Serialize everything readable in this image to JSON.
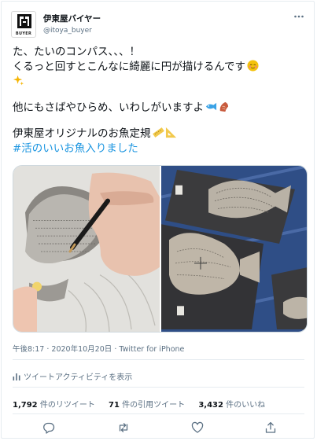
{
  "account": {
    "display_name": "伊東屋バイヤー",
    "handle": "@itoya_buyer",
    "avatar_text": "BUYER"
  },
  "tweet": {
    "line1": "た、たいのコンパス、、、！",
    "line2": "くるっと回すとこんなに綺麗に円が描けるんです",
    "line4": "他にもさばやひらめ、いわしがいますよ",
    "line5": "伊東屋オリジナルのお魚定規",
    "hashtag": "#活のいいお魚入りました"
  },
  "meta": {
    "time": "午後8:17",
    "date": "2020年10月20日",
    "source": "Twitter for iPhone"
  },
  "activity_label": "ツイートアクティビティを表示",
  "stats": {
    "retweets_count": "1,792",
    "retweets_label": "件のリツイート",
    "quotes_count": "71",
    "quotes_label": "件の引用ツイート",
    "likes_count": "3,432",
    "likes_label": "件のいいね"
  },
  "icons": {
    "more": "more-icon",
    "reply": "reply-icon",
    "retweet": "retweet-icon",
    "like": "like-icon",
    "share": "share-icon"
  },
  "colors": {
    "link": "#1b95e0",
    "secondary_text": "#5b7083",
    "border": "#e6ecf0"
  }
}
